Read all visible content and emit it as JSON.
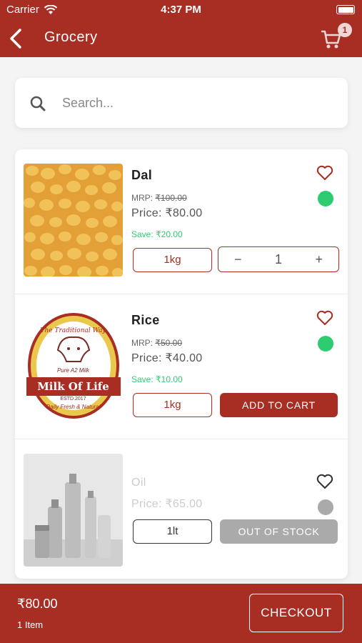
{
  "status_bar": {
    "carrier": "Carrier",
    "time": "4:37 PM"
  },
  "header": {
    "title": "Grocery",
    "cart_count": "1"
  },
  "search": {
    "placeholder": "Search..."
  },
  "colors": {
    "brand": "#a82e23",
    "available": "#2ecc71",
    "unavailable": "#aaaaaa"
  },
  "products": [
    {
      "name": "Dal",
      "mrp_label": "MRP:",
      "mrp": "₹100.00",
      "price": "Price: ₹80.00",
      "save": "Save: ₹20.00",
      "unit": "1kg",
      "quantity": "1",
      "stepper_minus": "−",
      "stepper_plus": "+"
    },
    {
      "name": "Rice",
      "mrp_label": "MRP:",
      "mrp": "₹50.00",
      "price": "Price: ₹40.00",
      "save": "Save: ₹10.00",
      "unit": "1kg",
      "action": "ADD TO CART",
      "logo_text": {
        "arc": "The Traditional Way",
        "brand": "Milk Of Life",
        "sub": "Pure A2 Milk",
        "est": "ESTD.2017",
        "tagline": "Daily Fresh & Natural"
      }
    },
    {
      "name": "Oil",
      "price": "Price: ₹65.00",
      "unit": "1lt",
      "action": "OUT OF STOCK"
    }
  ],
  "footer": {
    "total": "₹80.00",
    "items": "1 Item",
    "checkout": "CHECKOUT"
  }
}
